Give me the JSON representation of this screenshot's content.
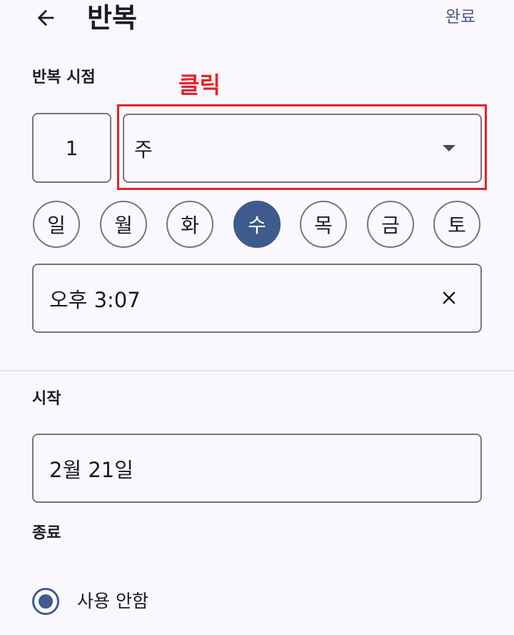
{
  "header": {
    "title": "반복",
    "done_label": "완료"
  },
  "annotation": {
    "text": "클릭",
    "color": "#e3262b"
  },
  "repeat": {
    "section_label": "반복 시점",
    "count_value": "1",
    "period_value": "주"
  },
  "days": [
    {
      "label": "일",
      "selected": false
    },
    {
      "label": "월",
      "selected": false
    },
    {
      "label": "화",
      "selected": false
    },
    {
      "label": "수",
      "selected": true
    },
    {
      "label": "목",
      "selected": false
    },
    {
      "label": "금",
      "selected": false
    },
    {
      "label": "토",
      "selected": false
    }
  ],
  "time": {
    "value": "오후 3:07"
  },
  "start": {
    "section_label": "시작",
    "value": "2월 21일"
  },
  "end": {
    "section_label": "종료",
    "options": [
      {
        "label": "사용 안함",
        "selected": true
      }
    ]
  },
  "colors": {
    "accent": "#3f5a8c",
    "background": "#faf8fd",
    "annotation": "#e0242b"
  },
  "icons": {
    "back": "arrow-left-icon",
    "dropdown": "caret-down-icon",
    "clear": "close-icon"
  }
}
